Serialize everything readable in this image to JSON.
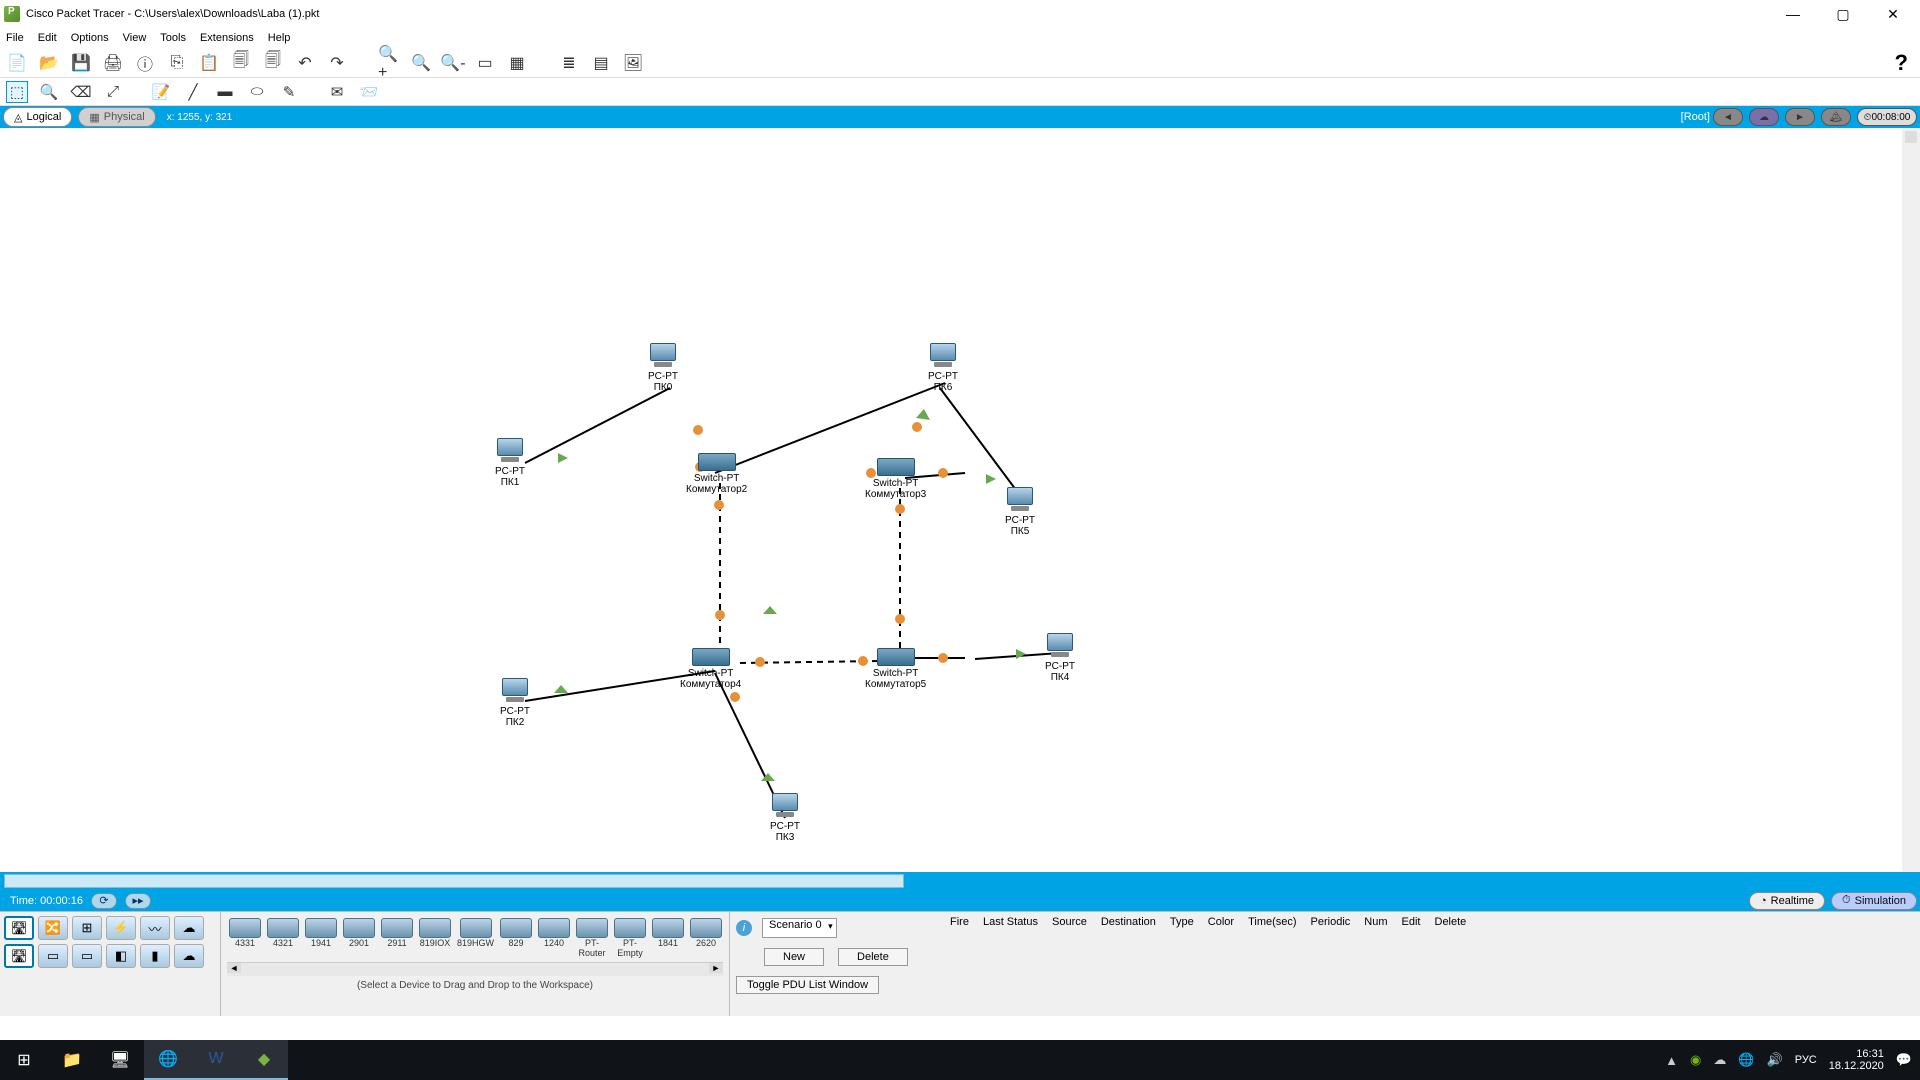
{
  "window": {
    "title": "Cisco Packet Tracer - C:\\Users\\alex\\Downloads\\Laba (1).pkt"
  },
  "menu": {
    "file": "File",
    "edit": "Edit",
    "options": "Options",
    "view": "View",
    "tools": "Tools",
    "extensions": "Extensions",
    "help": "Help"
  },
  "viewbar": {
    "logical": "Logical",
    "physical": "Physical",
    "coords": "x: 1255, y: 321",
    "root": "[Root]",
    "time": "00:08:00"
  },
  "devices": {
    "pc0": {
      "type": "PC-PT",
      "name": "ПК0"
    },
    "pc1": {
      "type": "PC-PT",
      "name": "ПК1"
    },
    "pc2": {
      "type": "PC-PT",
      "name": "ПК2"
    },
    "pc3": {
      "type": "PC-PT",
      "name": "ПК3"
    },
    "pc4": {
      "type": "PC-PT",
      "name": "ПК4"
    },
    "pc5": {
      "type": "PC-PT",
      "name": "ПК5"
    },
    "pc6": {
      "type": "PC-PT",
      "name": "ПК6"
    },
    "sw2": {
      "type": "Switch-PT",
      "name": "Коммутатор2"
    },
    "sw3": {
      "type": "Switch-PT",
      "name": "Коммутатор3"
    },
    "sw4": {
      "type": "Switch-PT",
      "name": "Коммутатор4"
    },
    "sw5": {
      "type": "Switch-PT",
      "name": "Коммутатор5"
    }
  },
  "timebar": {
    "label": "Time: 00:00:16",
    "realtime": "Realtime",
    "simulation": "Simulation"
  },
  "routers": [
    "4331",
    "4321",
    "1941",
    "2901",
    "2911",
    "819IOX",
    "819HGW",
    "829",
    "1240",
    "PT-Router",
    "PT-Empty",
    "1841",
    "2620"
  ],
  "selectText": "(Select a Device to Drag and Drop to the Workspace)",
  "pdu": {
    "scenario": "Scenario 0",
    "headers": [
      "Fire",
      "Last Status",
      "Source",
      "Destination",
      "Type",
      "Color",
      "Time(sec)",
      "Periodic",
      "Num",
      "Edit",
      "Delete"
    ],
    "new": "New",
    "delete": "Delete",
    "toggle": "Toggle PDU List Window"
  },
  "tray": {
    "lang": "РУС",
    "time": "16:31",
    "date": "18.12.2020"
  }
}
